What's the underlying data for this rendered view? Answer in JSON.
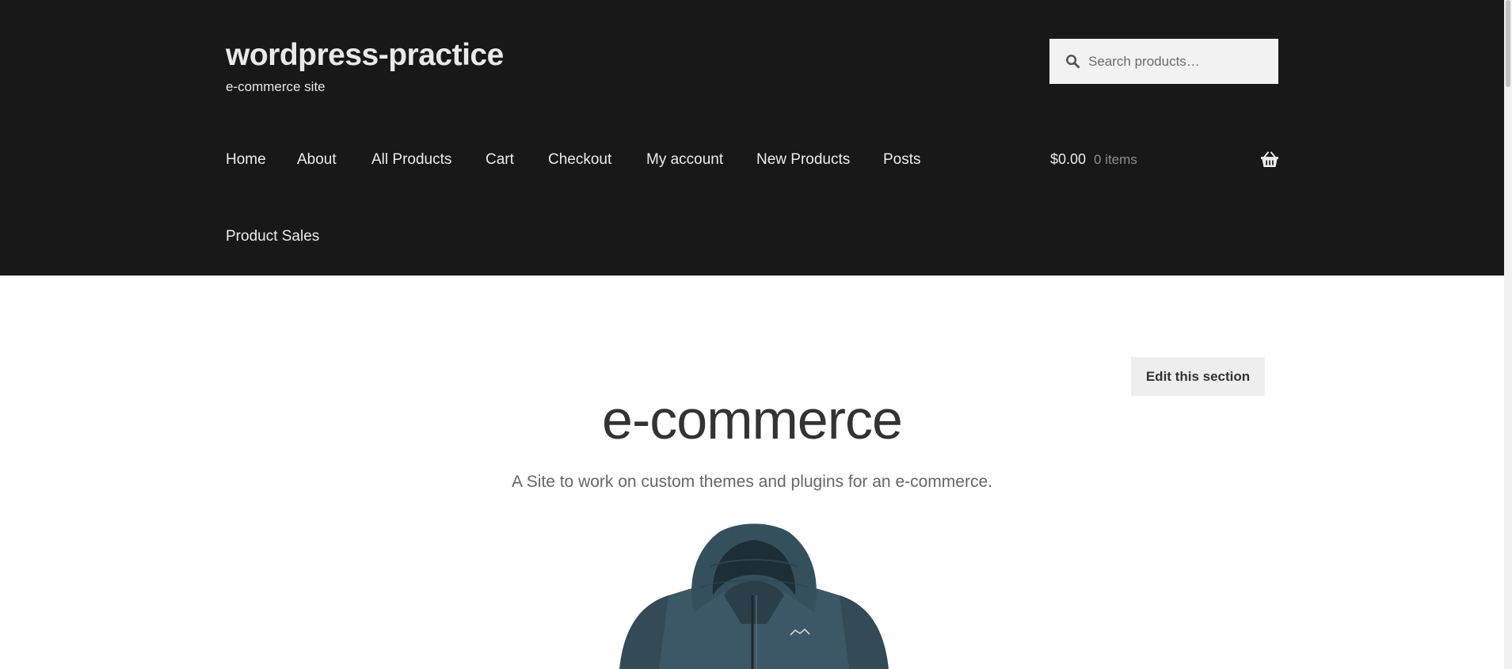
{
  "site": {
    "title": "wordpress-practice",
    "tagline": "e-commerce site"
  },
  "search": {
    "placeholder": "Search products…"
  },
  "nav": {
    "items": [
      {
        "label": "Home"
      },
      {
        "label": "About"
      },
      {
        "label": "All Products"
      },
      {
        "label": "Cart"
      },
      {
        "label": "Checkout"
      },
      {
        "label": "My account"
      },
      {
        "label": "New Products"
      },
      {
        "label": "Posts"
      },
      {
        "label": "Product Sales"
      }
    ]
  },
  "cart": {
    "total": "$0.00",
    "count": "0 items",
    "icon": "basket-icon"
  },
  "section": {
    "edit_label": "Edit this section",
    "title": "e-commerce",
    "description": "A Site to work on custom themes and plugins for an e-commerce."
  },
  "product_image": {
    "brand_mark": "ARC'TERYX"
  },
  "colors": {
    "header_bg": "#181818",
    "jacket": "#3c5866"
  }
}
